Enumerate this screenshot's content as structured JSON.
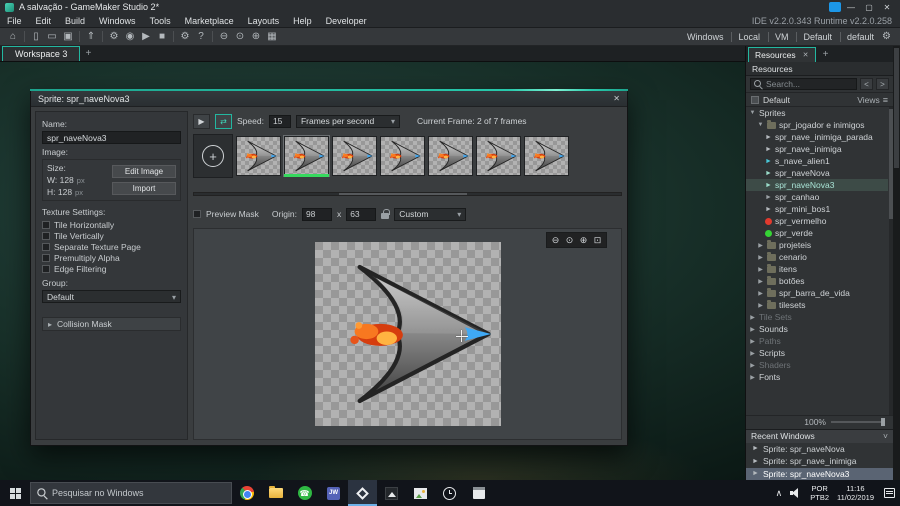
{
  "titlebar": {
    "title": "A salvação - GameMaker Studio 2*",
    "version_info": "IDE v2.2.0.343 Runtime v2.2.0.258"
  },
  "menubar": {
    "menus": [
      "File",
      "Edit",
      "Build",
      "Windows",
      "Tools",
      "Marketplace",
      "Layouts",
      "Help",
      "Developer"
    ]
  },
  "toolbar": {
    "left_icons": [
      "home",
      "sep",
      "new-file",
      "open-file",
      "save-all",
      "sep",
      "export",
      "sep",
      "run-gear",
      "debug",
      "run",
      "stop",
      "sep",
      "settings",
      "help",
      "sep",
      "zoom-out",
      "zoom-actual",
      "zoom-in",
      "windows-layout"
    ],
    "target_segments": [
      "Windows",
      "Local",
      "VM",
      "Default",
      "default"
    ]
  },
  "workspace": {
    "tab_label": "Workspace 3"
  },
  "sprite_window": {
    "title": "Sprite: spr_naveNova3",
    "left_panel": {
      "name_label": "Name:",
      "name_value": "spr_naveNova3",
      "image_label": "Image:",
      "size_label": "Size:",
      "width_value": "W: 128",
      "height_value": "H: 128",
      "px_label": "px",
      "edit_image_button": "Edit Image",
      "import_button": "Import",
      "texture_settings_label": "Texture Settings:",
      "texture_options": [
        "Tile Horizontally",
        "Tile Vertically",
        "Separate Texture Page",
        "Premultiply Alpha",
        "Edge Filtering"
      ],
      "group_label": "Group:",
      "group_value": "Default",
      "collision_mask_label": "Collision Mask"
    },
    "playback": {
      "speed_label": "Speed:",
      "speed_value": "15",
      "speed_unit": "Frames per second",
      "current_frame_label": "Current Frame: 2 of 7 frames"
    },
    "frames": {
      "count": 7,
      "selected_index": 1
    },
    "origin_row": {
      "preview_mask_label": "Preview Mask",
      "origin_label": "Origin:",
      "origin_x": "98",
      "separator": "x",
      "origin_y": "63",
      "mode_value": "Custom"
    }
  },
  "resources_panel": {
    "tab_label": "Resources",
    "panel_title": "Resources",
    "search_placeholder": "Search...",
    "root_label": "Default",
    "views_label": "Views",
    "tree": [
      {
        "label": "Sprites",
        "depth": 0,
        "type": "section",
        "chevron": "expanded"
      },
      {
        "label": "spr_jogador e inimigos",
        "depth": 1,
        "type": "folder",
        "chevron": "expanded"
      },
      {
        "label": "spr_nave_inimiga_parada",
        "depth": 2,
        "type": "sprite"
      },
      {
        "label": "spr_nave_inimiga",
        "depth": 2,
        "type": "sprite"
      },
      {
        "label": "s_nave_alien1",
        "depth": 2,
        "type": "sprite",
        "color": "#49c8d8"
      },
      {
        "label": "spr_naveNova",
        "depth": 2,
        "type": "sprite",
        "color": "#9adbc9"
      },
      {
        "label": "spr_naveNova3",
        "depth": 2,
        "type": "sprite",
        "color": "#9adbc9",
        "selected": true
      },
      {
        "label": "spr_canhao",
        "depth": 2,
        "type": "sprite",
        "color": "#9aa0a4"
      },
      {
        "label": "spr_mini_bos1",
        "depth": 2,
        "type": "sprite"
      },
      {
        "label": "spr_vermelho",
        "depth": 2,
        "type": "dot",
        "color": "#e23a2e"
      },
      {
        "label": "spr_verde",
        "depth": 2,
        "type": "dot",
        "color": "#35d435"
      },
      {
        "label": "projeteis",
        "depth": 1,
        "type": "folder",
        "chevron": "collapsed"
      },
      {
        "label": "cenario",
        "depth": 1,
        "type": "folder",
        "chevron": "collapsed"
      },
      {
        "label": "itens",
        "depth": 1,
        "type": "folder",
        "chevron": "collapsed"
      },
      {
        "label": "botões",
        "depth": 1,
        "type": "folder",
        "chevron": "collapsed"
      },
      {
        "label": "spr_barra_de_vida",
        "depth": 1,
        "type": "folder",
        "chevron": "collapsed"
      },
      {
        "label": "tilesets",
        "depth": 1,
        "type": "folder",
        "chevron": "collapsed"
      },
      {
        "label": "Tile Sets",
        "depth": 0,
        "type": "section",
        "chevron": "collapsed",
        "dimmed": true
      },
      {
        "label": "Sounds",
        "depth": 0,
        "type": "section",
        "chevron": "collapsed"
      },
      {
        "label": "Paths",
        "depth": 0,
        "type": "section",
        "chevron": "collapsed",
        "dimmed": true
      },
      {
        "label": "Scripts",
        "depth": 0,
        "type": "section",
        "chevron": "collapsed"
      },
      {
        "label": "Shaders",
        "depth": 0,
        "type": "section",
        "chevron": "collapsed",
        "dimmed": true
      },
      {
        "label": "Fonts",
        "depth": 0,
        "type": "section",
        "chevron": "collapsed"
      }
    ],
    "zoom_label": "100%",
    "recent_windows": {
      "title": "Recent Windows",
      "items": [
        {
          "label": "Sprite: spr_naveNova",
          "selected": false
        },
        {
          "label": "Sprite: spr_nave_inimiga",
          "selected": false
        },
        {
          "label": "Sprite: spr_naveNova3",
          "selected": true
        }
      ]
    }
  },
  "taskbar": {
    "search_placeholder": "Pesquisar no Windows",
    "app_icons": [
      {
        "name": "chrome",
        "active": false
      },
      {
        "name": "file-explorer",
        "active": false
      },
      {
        "name": "whatsapp",
        "active": false
      },
      {
        "name": "jw-library",
        "active": false,
        "badge": "JW"
      },
      {
        "name": "gamemaker-studio",
        "active": true
      },
      {
        "name": "photos-dark",
        "active": false
      },
      {
        "name": "pictures",
        "active": false
      },
      {
        "name": "clock",
        "active": false
      },
      {
        "name": "calendar",
        "active": false
      }
    ],
    "tray": {
      "language": "POR",
      "keyboard_layout": "PTB2",
      "time": "11:16",
      "date": "11/02/2019"
    }
  }
}
